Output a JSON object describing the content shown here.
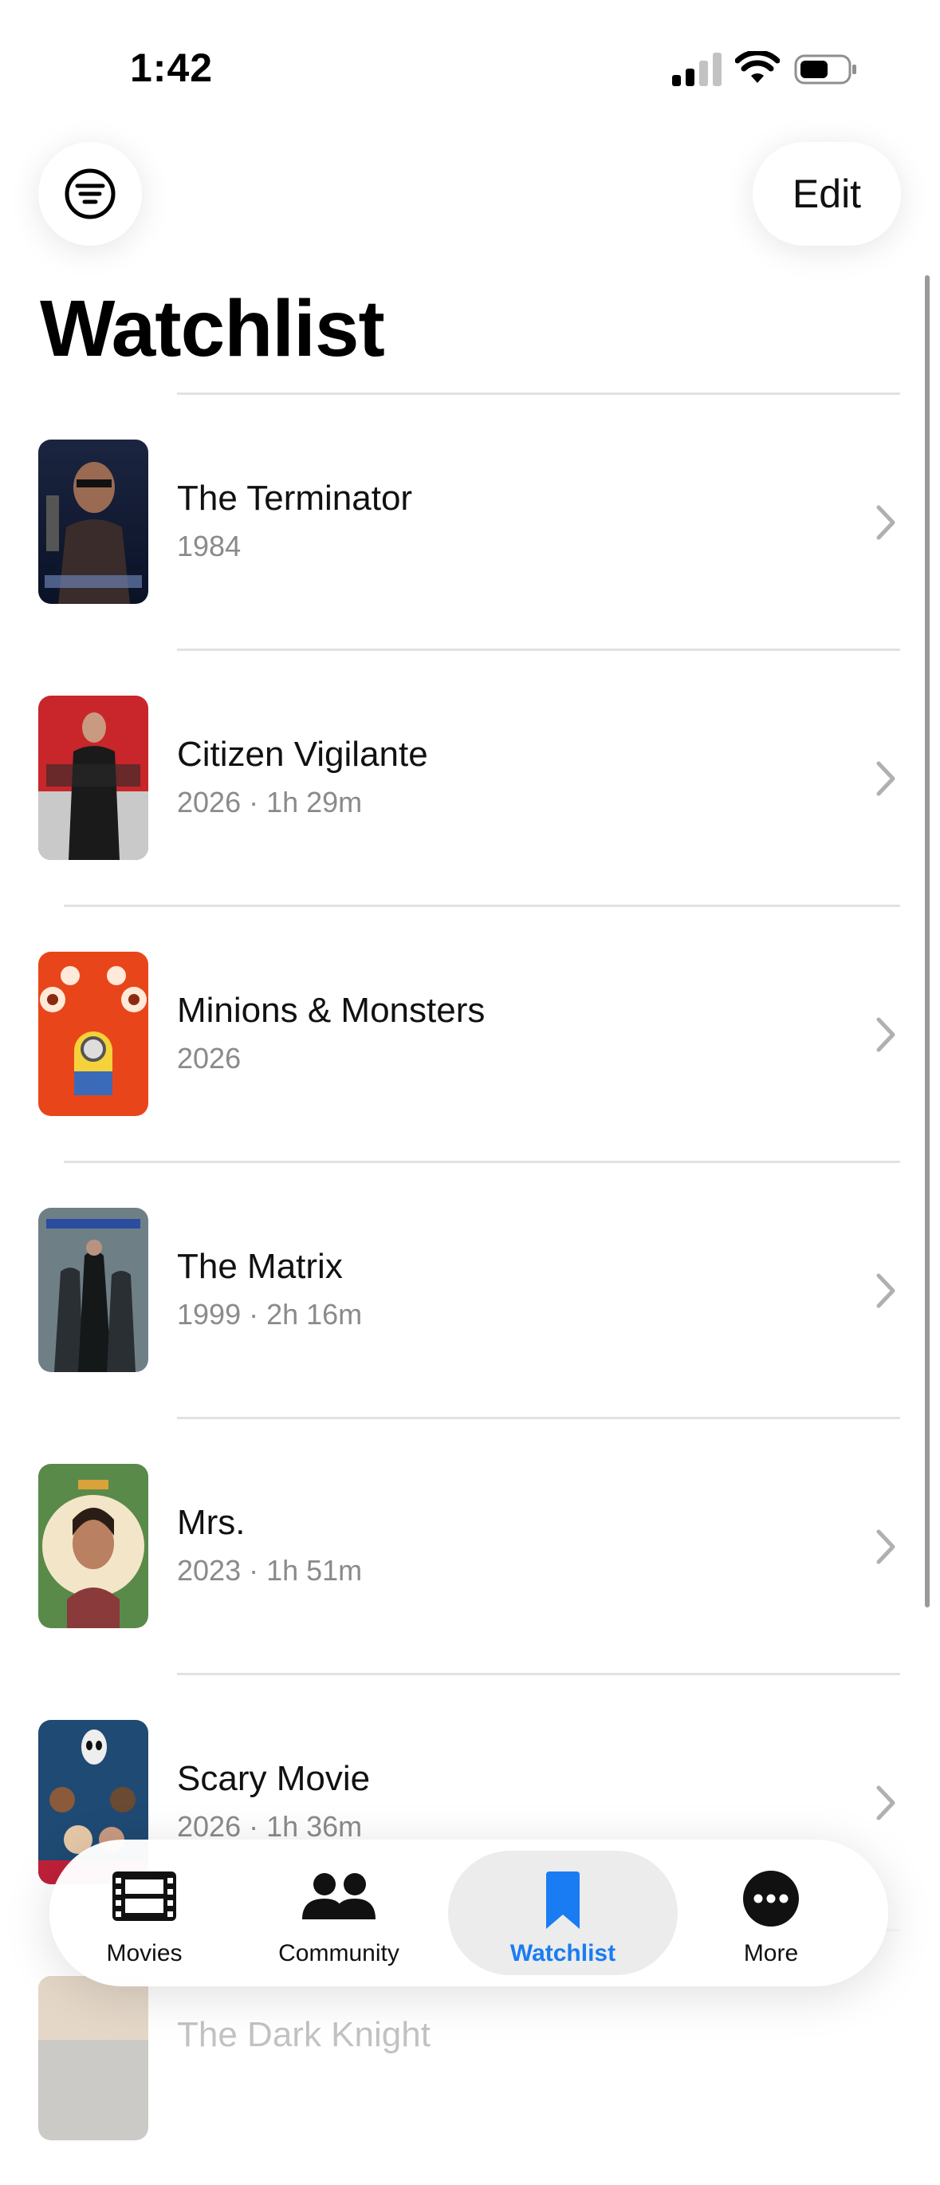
{
  "status_bar": {
    "time": "1:42"
  },
  "header": {
    "title": "Watchlist",
    "edit_label": "Edit"
  },
  "movies": [
    {
      "title": "The Terminator",
      "subtitle": "1984"
    },
    {
      "title": "Citizen Vigilante",
      "subtitle": "2026 · 1h 29m"
    },
    {
      "title": "Minions & Monsters",
      "subtitle": "2026"
    },
    {
      "title": "The Matrix",
      "subtitle": "1999 · 2h 16m"
    },
    {
      "title": "Mrs.",
      "subtitle": "2023 · 1h 51m"
    },
    {
      "title": "Scary Movie",
      "subtitle": "2026 · 1h 36m"
    },
    {
      "title": "The Dark Knight",
      "subtitle": ""
    }
  ],
  "tabs": [
    {
      "label": "Movies",
      "icon": "film-icon"
    },
    {
      "label": "Community",
      "icon": "people-icon"
    },
    {
      "label": "Watchlist",
      "icon": "bookmark-icon",
      "active": true
    },
    {
      "label": "More",
      "icon": "more-icon"
    }
  ],
  "colors": {
    "accent": "#1a7cf2",
    "secondary_text": "#8a8a8a",
    "separator": "#e2e2e2"
  }
}
